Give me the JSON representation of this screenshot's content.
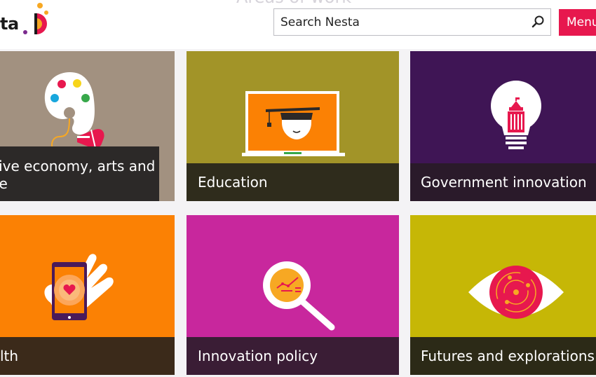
{
  "header": {
    "section_title": "Areas of work",
    "logo_text": "ta",
    "search": {
      "placeholder": "Search Nesta",
      "value": ""
    },
    "menu_label": "Menu"
  },
  "tiles": [
    {
      "label": "ative economy, arts and ure",
      "bg": "#a29180",
      "bar": "#2c2928",
      "icon": "palette-mouse-icon"
    },
    {
      "label": "Education",
      "bg": "#a29428",
      "bar": "#2f2c1c",
      "icon": "laptop-graduate-icon"
    },
    {
      "label": "Government innovation",
      "bg": "#3f1555",
      "bar": "#2a1a2a",
      "icon": "lightbulb-building-icon"
    },
    {
      "label": "lth",
      "bg": "#fb8104",
      "bar": "#3b2a1a",
      "icon": "hand-phone-heart-icon"
    },
    {
      "label": "Innovation policy",
      "bg": "#c8279d",
      "bar": "#3a1d35",
      "icon": "magnifier-chart-icon"
    },
    {
      "label": "Futures and explorations",
      "bg": "#c6b706",
      "bar": "#2c2a17",
      "icon": "eye-target-icon"
    }
  ]
}
